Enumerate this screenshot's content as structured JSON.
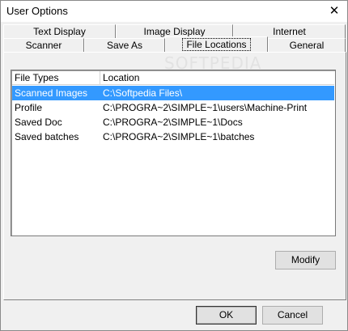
{
  "window": {
    "title": "User Options",
    "close_glyph": "✕"
  },
  "tabs": {
    "row1": [
      "Text Display",
      "Image Display",
      "Internet"
    ],
    "row2": [
      "Scanner",
      "Save As",
      "File Locations",
      "General"
    ],
    "active": "File Locations"
  },
  "watermark": "SOFTPEDIA",
  "list": {
    "headers": [
      "File Types",
      "Location"
    ],
    "rows": [
      {
        "type": "Scanned Images",
        "location": "C:\\Softpedia Files\\",
        "selected": true
      },
      {
        "type": "Profile",
        "location": "C:\\PROGRA~2\\SIMPLE~1\\users\\Machine-Print",
        "selected": false
      },
      {
        "type": "Saved Doc",
        "location": "C:\\PROGRA~2\\SIMPLE~1\\Docs",
        "selected": false
      },
      {
        "type": "Saved batches",
        "location": "C:\\PROGRA~2\\SIMPLE~1\\batches",
        "selected": false
      }
    ]
  },
  "buttons": {
    "modify": "Modify",
    "ok": "OK",
    "cancel": "Cancel"
  }
}
